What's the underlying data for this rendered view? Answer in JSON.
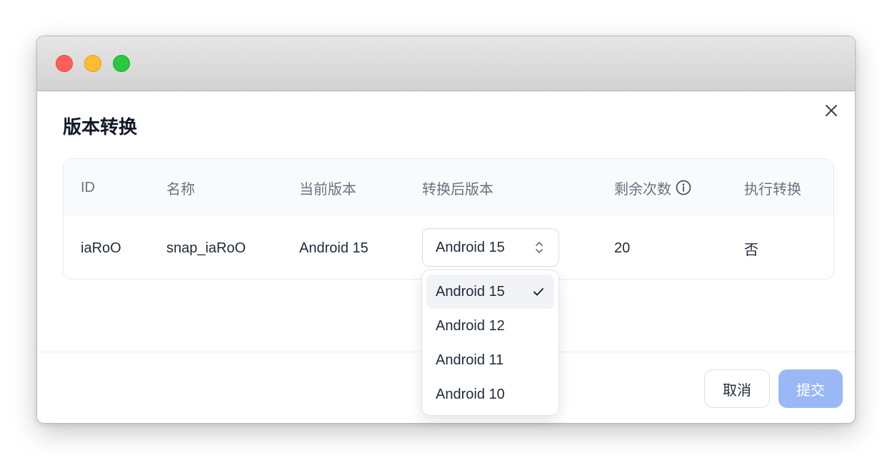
{
  "dialog": {
    "title": "版本转换",
    "close_icon": "close-icon"
  },
  "table": {
    "headers": {
      "id": "ID",
      "name": "名称",
      "current_version": "当前版本",
      "target_version": "转换后版本",
      "remaining": "剩余次数",
      "execute": "执行转换"
    },
    "row": {
      "id": "iaRoO",
      "name": "snap_iaRoO",
      "current_version": "Android 15",
      "target_version": "Android 15",
      "remaining": "20",
      "execute": "否"
    }
  },
  "dropdown": {
    "options": [
      "Android 15",
      "Android 12",
      "Android 11",
      "Android 10"
    ],
    "selected": "Android 15"
  },
  "footer": {
    "cancel_label": "取消",
    "submit_label": "提交"
  },
  "colors": {
    "submit_disabled": "#9bb8f6",
    "header_bg": "#f9fafb",
    "selected_option_bg": "#f1f3f7"
  }
}
